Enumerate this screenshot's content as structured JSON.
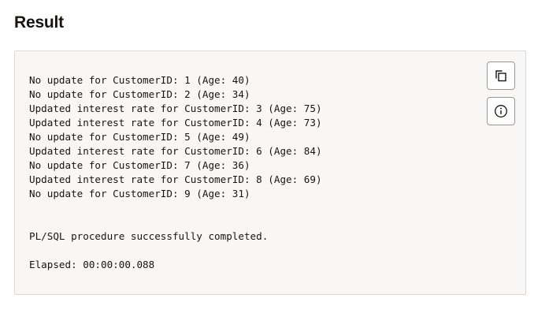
{
  "page": {
    "title": "Result"
  },
  "output": {
    "text": "No update for CustomerID: 1 (Age: 40)\nNo update for CustomerID: 2 (Age: 34)\nUpdated interest rate for CustomerID: 3 (Age: 75)\nUpdated interest rate for CustomerID: 4 (Age: 73)\nNo update for CustomerID: 5 (Age: 49)\nUpdated interest rate for CustomerID: 6 (Age: 84)\nNo update for CustomerID: 7 (Age: 36)\nUpdated interest rate for CustomerID: 8 (Age: 69)\nNo update for CustomerID: 9 (Age: 31)\n\n\nPL/SQL procedure successfully completed.\n\nElapsed: 00:00:00.088"
  },
  "toolbar": {
    "copy_icon": "copy-icon",
    "info_icon": "info-icon"
  },
  "colors": {
    "panel_background": "#f8f7f5",
    "panel_border": "#dcdad6",
    "text": "#161513",
    "button_border": "#9b9893"
  }
}
